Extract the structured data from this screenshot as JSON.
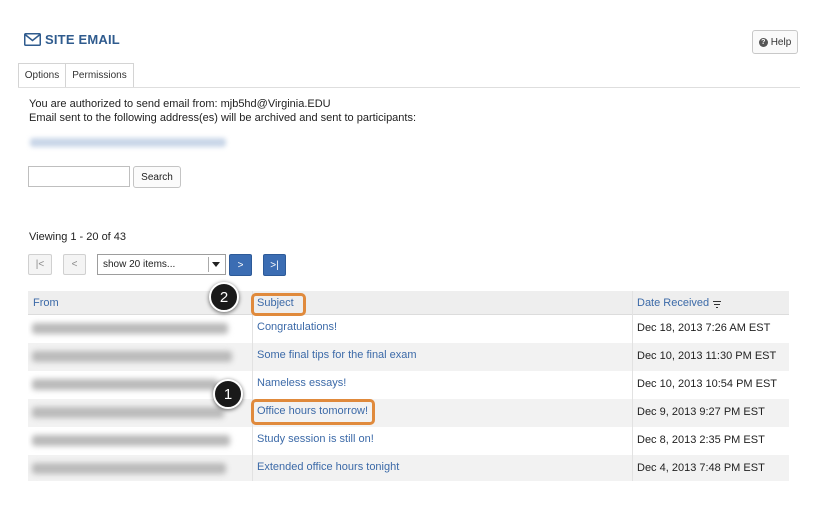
{
  "header": {
    "title": "SITE EMAIL",
    "help_label": "Help"
  },
  "tabs": [
    {
      "label": "Options"
    },
    {
      "label": "Permissions"
    }
  ],
  "info": {
    "authorized_line": "You are authorized to send email from: mjb5hd@Virginia.EDU",
    "archive_line": "Email sent to the following address(es) will be archived and sent to participants:"
  },
  "search": {
    "button_label": "Search",
    "value": ""
  },
  "pager": {
    "viewing_text": "Viewing 1 - 20 of 43",
    "first_label": "|<",
    "prev_label": "<",
    "page_size": "show 20 items...",
    "next_label": ">",
    "last_label": ">|"
  },
  "table": {
    "columns": {
      "from": "From",
      "subject": "Subject",
      "date": "Date Received"
    },
    "rows": [
      {
        "subject": "Congratulations!",
        "date": "Dec 18, 2013 7:26 AM EST"
      },
      {
        "subject": "Some final tips for the final exam",
        "date": "Dec 10, 2013 11:30 PM EST"
      },
      {
        "subject": "Nameless essays!",
        "date": "Dec 10, 2013 10:54 PM EST"
      },
      {
        "subject": "Office hours tomorrow!",
        "date": "Dec 9, 2013 9:27 PM EST"
      },
      {
        "subject": "Study session is still on!",
        "date": "Dec 8, 2013 2:35 PM EST"
      },
      {
        "subject": "Extended office hours tonight",
        "date": "Dec 4, 2013 7:48 PM EST"
      }
    ]
  },
  "callouts": [
    {
      "number": "1"
    },
    {
      "number": "2"
    }
  ],
  "colors": {
    "accent": "#3b6db3",
    "link": "#3c6aa8",
    "highlight": "#e08a3c"
  }
}
